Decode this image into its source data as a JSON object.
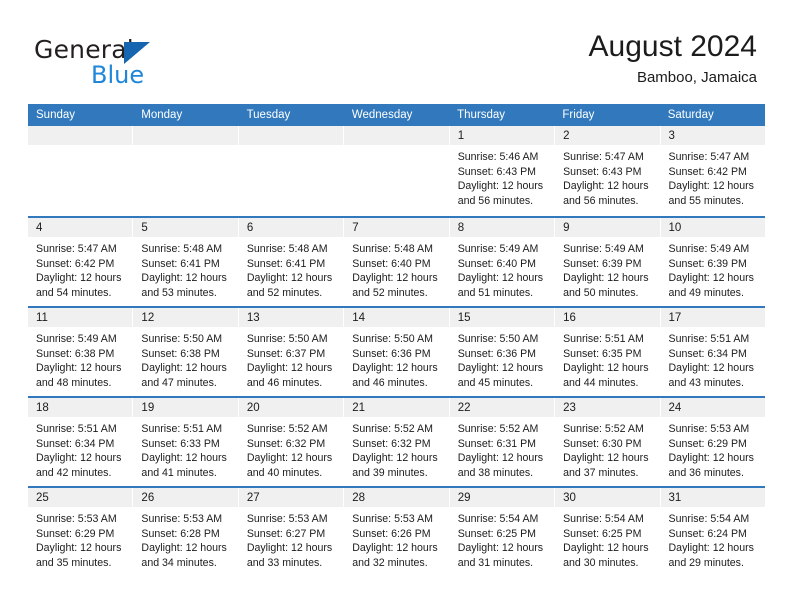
{
  "brand": {
    "name_part1": "General",
    "name_part2": "Blue",
    "logo_icon": "triangle-logo-icon",
    "accent_dark": "#1565b0",
    "accent_light": "#1f86d9"
  },
  "header": {
    "month_title": "August 2024",
    "location": "Bamboo, Jamaica"
  },
  "colors": {
    "header_blue": "#3179bc",
    "day_strip_gray": "#f0f0f0",
    "cell_white": "#ffffff",
    "text": "#1c1c1c"
  },
  "weekdays": [
    "Sunday",
    "Monday",
    "Tuesday",
    "Wednesday",
    "Thursday",
    "Friday",
    "Saturday"
  ],
  "weeks": [
    [
      {
        "day": "",
        "lines": []
      },
      {
        "day": "",
        "lines": []
      },
      {
        "day": "",
        "lines": []
      },
      {
        "day": "",
        "lines": []
      },
      {
        "day": "1",
        "lines": [
          "Sunrise: 5:46 AM",
          "Sunset: 6:43 PM",
          "Daylight: 12 hours",
          "and 56 minutes."
        ]
      },
      {
        "day": "2",
        "lines": [
          "Sunrise: 5:47 AM",
          "Sunset: 6:43 PM",
          "Daylight: 12 hours",
          "and 56 minutes."
        ]
      },
      {
        "day": "3",
        "lines": [
          "Sunrise: 5:47 AM",
          "Sunset: 6:42 PM",
          "Daylight: 12 hours",
          "and 55 minutes."
        ]
      }
    ],
    [
      {
        "day": "4",
        "lines": [
          "Sunrise: 5:47 AM",
          "Sunset: 6:42 PM",
          "Daylight: 12 hours",
          "and 54 minutes."
        ]
      },
      {
        "day": "5",
        "lines": [
          "Sunrise: 5:48 AM",
          "Sunset: 6:41 PM",
          "Daylight: 12 hours",
          "and 53 minutes."
        ]
      },
      {
        "day": "6",
        "lines": [
          "Sunrise: 5:48 AM",
          "Sunset: 6:41 PM",
          "Daylight: 12 hours",
          "and 52 minutes."
        ]
      },
      {
        "day": "7",
        "lines": [
          "Sunrise: 5:48 AM",
          "Sunset: 6:40 PM",
          "Daylight: 12 hours",
          "and 52 minutes."
        ]
      },
      {
        "day": "8",
        "lines": [
          "Sunrise: 5:49 AM",
          "Sunset: 6:40 PM",
          "Daylight: 12 hours",
          "and 51 minutes."
        ]
      },
      {
        "day": "9",
        "lines": [
          "Sunrise: 5:49 AM",
          "Sunset: 6:39 PM",
          "Daylight: 12 hours",
          "and 50 minutes."
        ]
      },
      {
        "day": "10",
        "lines": [
          "Sunrise: 5:49 AM",
          "Sunset: 6:39 PM",
          "Daylight: 12 hours",
          "and 49 minutes."
        ]
      }
    ],
    [
      {
        "day": "11",
        "lines": [
          "Sunrise: 5:49 AM",
          "Sunset: 6:38 PM",
          "Daylight: 12 hours",
          "and 48 minutes."
        ]
      },
      {
        "day": "12",
        "lines": [
          "Sunrise: 5:50 AM",
          "Sunset: 6:38 PM",
          "Daylight: 12 hours",
          "and 47 minutes."
        ]
      },
      {
        "day": "13",
        "lines": [
          "Sunrise: 5:50 AM",
          "Sunset: 6:37 PM",
          "Daylight: 12 hours",
          "and 46 minutes."
        ]
      },
      {
        "day": "14",
        "lines": [
          "Sunrise: 5:50 AM",
          "Sunset: 6:36 PM",
          "Daylight: 12 hours",
          "and 46 minutes."
        ]
      },
      {
        "day": "15",
        "lines": [
          "Sunrise: 5:50 AM",
          "Sunset: 6:36 PM",
          "Daylight: 12 hours",
          "and 45 minutes."
        ]
      },
      {
        "day": "16",
        "lines": [
          "Sunrise: 5:51 AM",
          "Sunset: 6:35 PM",
          "Daylight: 12 hours",
          "and 44 minutes."
        ]
      },
      {
        "day": "17",
        "lines": [
          "Sunrise: 5:51 AM",
          "Sunset: 6:34 PM",
          "Daylight: 12 hours",
          "and 43 minutes."
        ]
      }
    ],
    [
      {
        "day": "18",
        "lines": [
          "Sunrise: 5:51 AM",
          "Sunset: 6:34 PM",
          "Daylight: 12 hours",
          "and 42 minutes."
        ]
      },
      {
        "day": "19",
        "lines": [
          "Sunrise: 5:51 AM",
          "Sunset: 6:33 PM",
          "Daylight: 12 hours",
          "and 41 minutes."
        ]
      },
      {
        "day": "20",
        "lines": [
          "Sunrise: 5:52 AM",
          "Sunset: 6:32 PM",
          "Daylight: 12 hours",
          "and 40 minutes."
        ]
      },
      {
        "day": "21",
        "lines": [
          "Sunrise: 5:52 AM",
          "Sunset: 6:32 PM",
          "Daylight: 12 hours",
          "and 39 minutes."
        ]
      },
      {
        "day": "22",
        "lines": [
          "Sunrise: 5:52 AM",
          "Sunset: 6:31 PM",
          "Daylight: 12 hours",
          "and 38 minutes."
        ]
      },
      {
        "day": "23",
        "lines": [
          "Sunrise: 5:52 AM",
          "Sunset: 6:30 PM",
          "Daylight: 12 hours",
          "and 37 minutes."
        ]
      },
      {
        "day": "24",
        "lines": [
          "Sunrise: 5:53 AM",
          "Sunset: 6:29 PM",
          "Daylight: 12 hours",
          "and 36 minutes."
        ]
      }
    ],
    [
      {
        "day": "25",
        "lines": [
          "Sunrise: 5:53 AM",
          "Sunset: 6:29 PM",
          "Daylight: 12 hours",
          "and 35 minutes."
        ]
      },
      {
        "day": "26",
        "lines": [
          "Sunrise: 5:53 AM",
          "Sunset: 6:28 PM",
          "Daylight: 12 hours",
          "and 34 minutes."
        ]
      },
      {
        "day": "27",
        "lines": [
          "Sunrise: 5:53 AM",
          "Sunset: 6:27 PM",
          "Daylight: 12 hours",
          "and 33 minutes."
        ]
      },
      {
        "day": "28",
        "lines": [
          "Sunrise: 5:53 AM",
          "Sunset: 6:26 PM",
          "Daylight: 12 hours",
          "and 32 minutes."
        ]
      },
      {
        "day": "29",
        "lines": [
          "Sunrise: 5:54 AM",
          "Sunset: 6:25 PM",
          "Daylight: 12 hours",
          "and 31 minutes."
        ]
      },
      {
        "day": "30",
        "lines": [
          "Sunrise: 5:54 AM",
          "Sunset: 6:25 PM",
          "Daylight: 12 hours",
          "and 30 minutes."
        ]
      },
      {
        "day": "31",
        "lines": [
          "Sunrise: 5:54 AM",
          "Sunset: 6:24 PM",
          "Daylight: 12 hours",
          "and 29 minutes."
        ]
      }
    ]
  ]
}
